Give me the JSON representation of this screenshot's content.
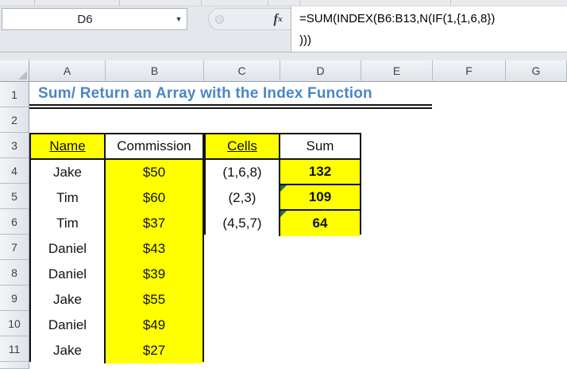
{
  "toolbar": {
    "name_box_value": "D6",
    "fx_label": "f",
    "fx_sub": "x",
    "formula_line1": "=SUM(INDEX(B6:B13,N(IF(1,{1,6,8})",
    "formula_line2": ")))"
  },
  "sheet": {
    "title": "Sum/ Return an Array with the Index Function",
    "column_headers": [
      "A",
      "B",
      "C",
      "D",
      "E",
      "F",
      "G"
    ],
    "row_headers": [
      "1",
      "2",
      "3",
      "4",
      "5",
      "6",
      "7",
      "8",
      "9",
      "10",
      "11"
    ]
  },
  "commission_table": {
    "name_header": "Name",
    "commission_header": "Commission",
    "rows": [
      {
        "name": "Jake",
        "commission": "$50"
      },
      {
        "name": "Tim",
        "commission": "$60"
      },
      {
        "name": "Tim",
        "commission": "$37"
      },
      {
        "name": "Daniel",
        "commission": "$43"
      },
      {
        "name": "Daniel",
        "commission": "$39"
      },
      {
        "name": "Jake",
        "commission": "$55"
      },
      {
        "name": "Daniel",
        "commission": "$49"
      },
      {
        "name": "Jake",
        "commission": "$27"
      }
    ]
  },
  "sum_table": {
    "cells_header": "Cells",
    "sum_header": "Sum",
    "rows": [
      {
        "cells": "(1,6,8)",
        "sum": "132",
        "error_indicator": false
      },
      {
        "cells": "(2,3)",
        "sum": "109",
        "error_indicator": true
      },
      {
        "cells": "(4,5,7)",
        "sum": "64",
        "error_indicator": true
      }
    ]
  },
  "colors": {
    "highlight_yellow": "#FFFF00",
    "header_red": "#FF0000",
    "title_blue": "#4A86C8",
    "error_indicator_green": "#217346"
  }
}
